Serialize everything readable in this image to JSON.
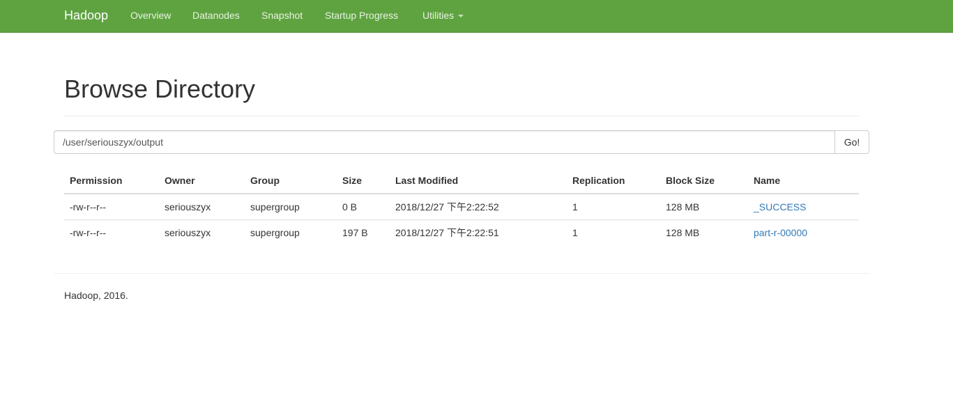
{
  "navbar": {
    "brand": "Hadoop",
    "items": [
      "Overview",
      "Datanodes",
      "Snapshot",
      "Startup Progress",
      "Utilities"
    ],
    "background_color": "#5fa341"
  },
  "page_title": "Browse Directory",
  "path_input": {
    "value": "/user/seriouszyx/output"
  },
  "go_button_label": "Go!",
  "table": {
    "headers": [
      "Permission",
      "Owner",
      "Group",
      "Size",
      "Last Modified",
      "Replication",
      "Block Size",
      "Name"
    ],
    "rows": [
      [
        "-rw-r--r--",
        "seriouszyx",
        "supergroup",
        "0 B",
        "2018/12/27 下午2:22:52",
        "1",
        "128 MB",
        "_SUCCESS"
      ],
      [
        "-rw-r--r--",
        "seriouszyx",
        "supergroup",
        "197 B",
        "2018/12/27 下午2:22:51",
        "1",
        "128 MB",
        "part-r-00000"
      ]
    ],
    "link_color": "#337ab7"
  },
  "footer": "Hadoop, 2016."
}
